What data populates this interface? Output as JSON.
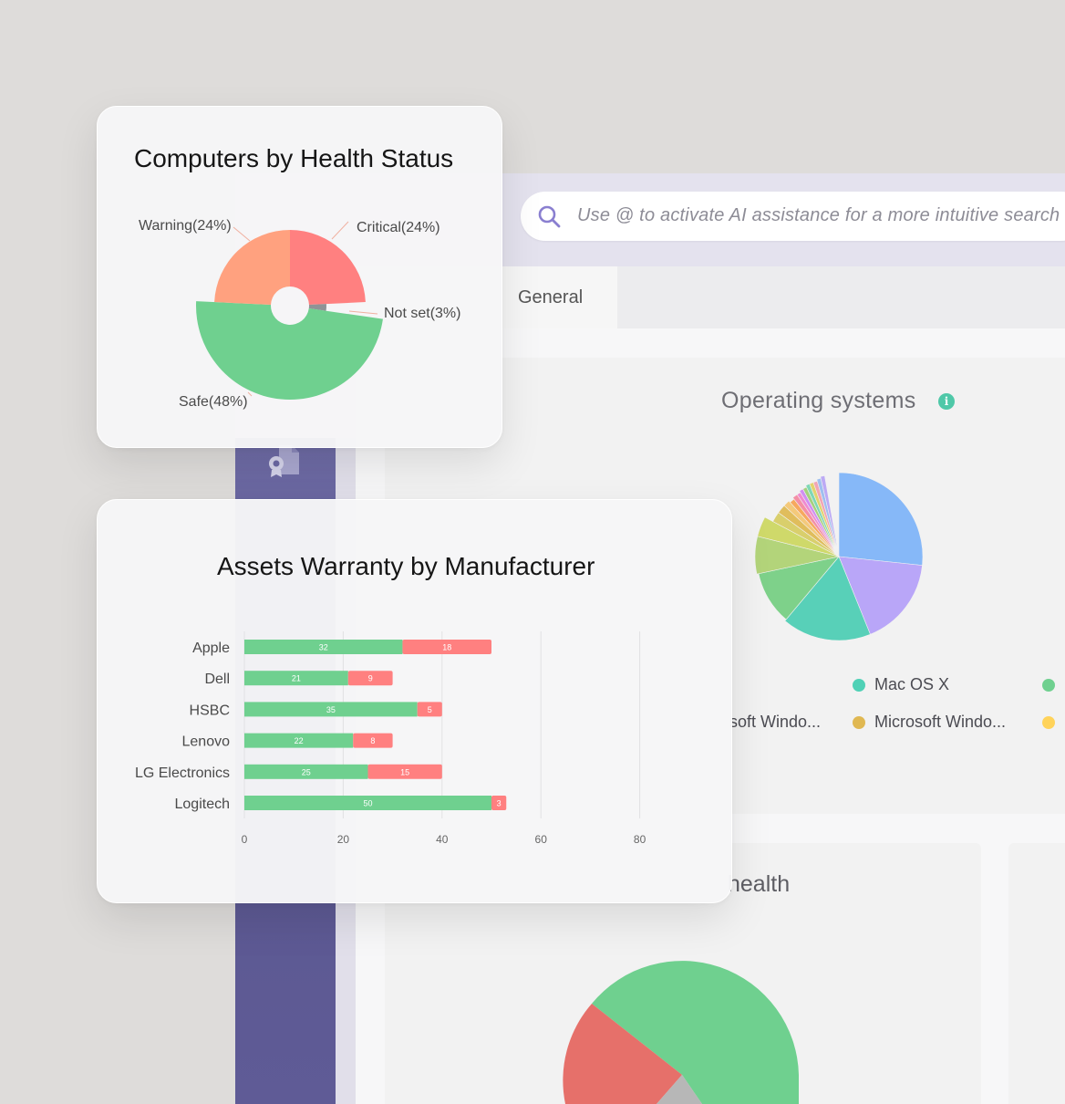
{
  "search": {
    "placeholder": "Use @ to activate AI assistance for a more intuitive search"
  },
  "tabs": [
    {
      "label": "General"
    }
  ],
  "os_panel": {
    "title": "Operating systems",
    "legend": [
      {
        "label": "Mac OS X",
        "color": "#4fd1b6"
      },
      {
        "label": "Microsoft Windo...",
        "color": "#e0b852"
      },
      {
        "label": "soft Windo..."
      }
    ]
  },
  "health_panel": {
    "title": "health"
  },
  "health_card": {
    "title": "Computers by Health Status",
    "slices": [
      {
        "label": "Critical(24%)",
        "percent": 24,
        "color": "#ff8080"
      },
      {
        "label": "Not set(3%)",
        "percent": 3,
        "color": "#8f9396"
      },
      {
        "label": "Safe(48%)",
        "percent": 48,
        "color": "#6fd08f"
      },
      {
        "label": "Warning(24%)",
        "percent": 24,
        "color": "#ffa17f"
      }
    ]
  },
  "chart_data": {
    "type": "bar",
    "title": "Assets Warranty by Manufacturer",
    "orientation": "horizontal",
    "stacked": true,
    "categories": [
      "Apple",
      "Dell",
      "HSBC",
      "Lenovo",
      "LG Electronics",
      "Logitech"
    ],
    "series": [
      {
        "values": [
          32,
          21,
          35,
          22,
          25,
          50
        ],
        "color": "#6fd08f"
      },
      {
        "values": [
          18,
          9,
          5,
          8,
          15,
          3
        ],
        "color": "#ff8080"
      }
    ],
    "xlim": [
      0,
      80
    ],
    "xticks": [
      0,
      20,
      40,
      60,
      80
    ],
    "grid": true
  }
}
